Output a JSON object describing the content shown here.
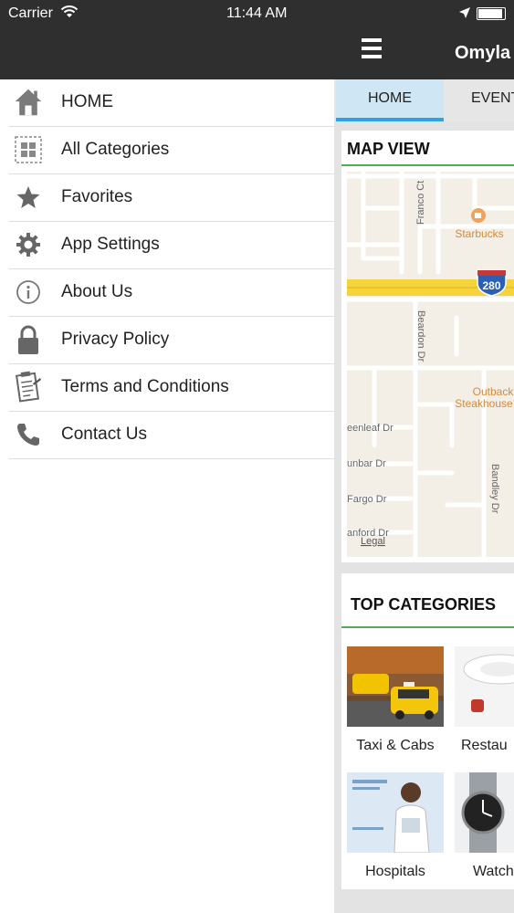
{
  "status_bar": {
    "carrier": "Carrier",
    "time": "11:44 AM"
  },
  "drawer": {
    "items": [
      {
        "label": "HOME",
        "icon": "home-icon"
      },
      {
        "label": "All Categories",
        "icon": "grid-icon"
      },
      {
        "label": "Favorites",
        "icon": "star-icon"
      },
      {
        "label": "App Settings",
        "icon": "gear-icon"
      },
      {
        "label": "About Us",
        "icon": "info-icon"
      },
      {
        "label": "Privacy Policy",
        "icon": "lock-icon"
      },
      {
        "label": "Terms and Conditions",
        "icon": "clipboard-icon"
      },
      {
        "label": "Contact Us",
        "icon": "phone-icon"
      }
    ]
  },
  "main": {
    "app_title": "Omyla",
    "tabs": [
      {
        "label": "HOME"
      },
      {
        "label": "EVENT"
      }
    ],
    "map": {
      "title": "MAP VIEW",
      "labels": {
        "street_franco": "Franco Ct",
        "starbucks": "Starbucks",
        "highway": "280",
        "beardon": "Beardon Dr",
        "outback1": "Outback",
        "outback2": "Steakhouse",
        "greenleaf": "eenleaf Dr",
        "dunbar": "unbar Dr",
        "fargo": "Fargo Dr",
        "bandley": "Bandley Dr",
        "stanford": "anford Dr",
        "legal": "Legal"
      }
    },
    "top_categories": {
      "title": "TOP CATEGORIES",
      "items": [
        {
          "label": "Taxi & Cabs"
        },
        {
          "label": "Restau"
        },
        {
          "label": "Hospitals"
        },
        {
          "label": "Watch"
        }
      ]
    }
  },
  "colors": {
    "header_bg": "#2f2f2f",
    "accent_green": "#4caf50",
    "tab_active": "#cfe7f5",
    "tab_indicator": "#2fa4da"
  }
}
